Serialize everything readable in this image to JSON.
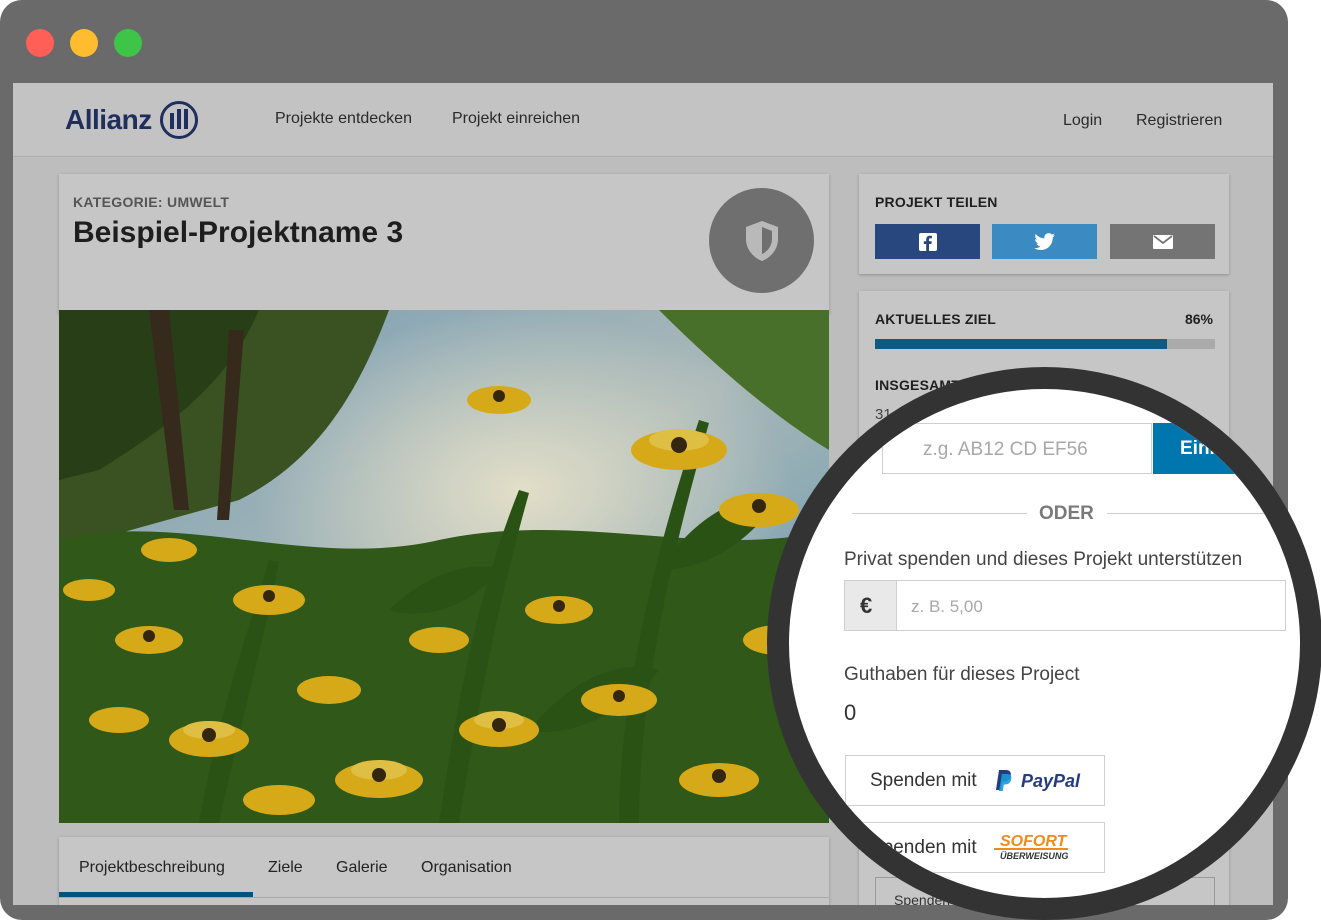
{
  "window": {
    "controls": [
      "close",
      "minimize",
      "maximize"
    ]
  },
  "brand": {
    "name": "Allianz",
    "mark_icon": "allianz-mark-icon"
  },
  "nav": {
    "links": [
      "Projekte entdecken",
      "Projekt einreichen"
    ],
    "login": "Login",
    "register": "Registrieren"
  },
  "project": {
    "category": "KATEGORIE: UMWELT",
    "title": "Beispiel-Projektname 3",
    "badge_icon": "shield-icon"
  },
  "tabs": [
    "Projektbeschreibung",
    "Ziele",
    "Galerie",
    "Organisation"
  ],
  "active_tab": "Projektbeschreibung",
  "share": {
    "heading": "PROJEKT TEILEN",
    "buttons": [
      {
        "icon": "facebook-icon",
        "color": "#27477e"
      },
      {
        "icon": "twitter-icon",
        "color": "#3c8ac2"
      },
      {
        "icon": "mail-icon",
        "color": "#747474"
      }
    ]
  },
  "goal": {
    "heading": "AKTUELLES ZIEL",
    "percent_label": "86%",
    "progress": 0.86,
    "total_heading": "INSGESAMT",
    "total_value": "31",
    "donate_stub": "Spenden"
  },
  "donation": {
    "code_placeholder": "z.g. AB12 CD EF56",
    "code_button": "Einlösen",
    "separator": "ODER",
    "private_label": "Privat spenden und dieses Projekt unterstützen",
    "currency_symbol": "€",
    "amount_placeholder": "z. B. 5,00",
    "balance_label": "Guthaben für dieses Project",
    "balance_value": "0",
    "paypal_prefix": "Spenden mit",
    "paypal_brand": "PayPal",
    "sofort_prefix": "Spenden mit",
    "sofort_brand": "SOFORT",
    "sofort_sub": "ÜBERWEISUNG"
  },
  "colors": {
    "brand_navy": "#1f2e5c",
    "accent_blue": "#0076ae",
    "progress_blue": "#0d5a82",
    "sofort_orange": "#f18a1c",
    "paypal_dark": "#253b80",
    "paypal_light": "#179bd7"
  }
}
